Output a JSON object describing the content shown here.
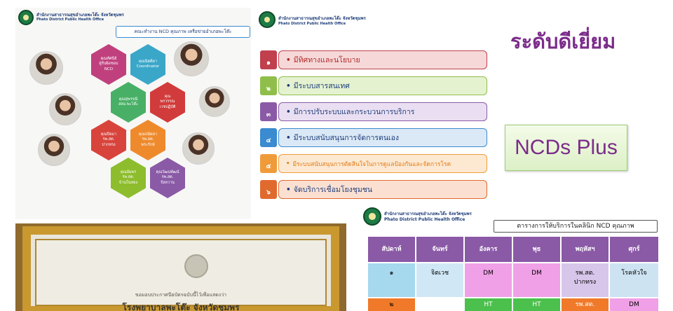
{
  "header": {
    "org_th": "สำนักงานสาธารณสุขอำเภอพะโต๊ะ จังหวัดชุมพร",
    "org_en": "Phato District Public Health Office"
  },
  "team_slide": {
    "title": "คณะทำงาน NCD คุณภาพ เครือข่ายอำเภอพะโต๊ะ",
    "hexes": [
      {
        "text": "คุณทัศนีย์\nผู้รับผิดชอบ\nNCD",
        "color": "#c0407e"
      },
      {
        "text": "คุณนิตติยา\nCoordinator",
        "color": "#3aa7c9"
      },
      {
        "text": "คุณสุพรรณี\nสสอ.พะโต๊ะ",
        "color": "#48b066"
      },
      {
        "text": "คุณ\nพรวรรณ\nเวชปฏิบัติ",
        "color": "#d23b3b"
      },
      {
        "text": "คุณปิยมา\nรพ.สต.\nปากทรง",
        "color": "#d8443c"
      },
      {
        "text": "คุณปนัดดา\nรพ.สต.\nพระรักษ์",
        "color": "#ef8a2c"
      },
      {
        "text": "คุณอัมพร\nรพ.สต.\nบ้านในหยง",
        "color": "#8dbd2c"
      },
      {
        "text": "คุณวัฒนพัฒน์\nรพ.สต.\nปังหวาน",
        "color": "#8a5aa6"
      }
    ]
  },
  "list_slide": {
    "items": [
      {
        "num": "๑",
        "label": "มีทิศทางและนโยบาย",
        "tab": "#c0404e",
        "fill": "#f6d8d8",
        "border": "#c0404e",
        "text": "#b02a2a"
      },
      {
        "num": "๒",
        "label": "มีระบบสารสนเทศ",
        "tab": "#8fbf4a",
        "fill": "#e4f2d0",
        "border": "#8fbf4a",
        "text": "#1f3e7a"
      },
      {
        "num": "๓",
        "label": "มีการปรับระบบและกระบวนการบริการ",
        "tab": "#8a5aa6",
        "fill": "#eadff2",
        "border": "#8a5aa6",
        "text": "#1f3e7a"
      },
      {
        "num": "๔",
        "label": "มีระบบสนับสนุนการจัดการตนเอง",
        "tab": "#3a8bd0",
        "fill": "#dbe9f7",
        "border": "#3a8bd0",
        "text": "#1f3e7a"
      },
      {
        "num": "๕",
        "label": "มีระบบสนับสนุนการตัดสินใจในการดูแลป้องกันและจัดการโรค",
        "tab": "#f09b3a",
        "fill": "#fde9d2",
        "border": "#f09b3a",
        "text": "#e07b1a"
      },
      {
        "num": "๖",
        "label": "จัดบริการเชื่อมโยงชุมชน",
        "tab": "#e06a2e",
        "fill": "#fbe0d2",
        "border": "#e06a2e",
        "text": "#1f3e7a"
      }
    ]
  },
  "right": {
    "title": "ระดับดีเยี่ยม",
    "box_label": "NCDs Plus"
  },
  "certificate": {
    "line1": "ขอมอบประกาศนียบัตรฉบับนี้ไว้เพื่อแสดงว่า",
    "line2": "โรงพยาบาลพะโต๊ะ จังหวัดชุมพร"
  },
  "schedule": {
    "title": "ตารางการให้บริการในคลินิก NCD คุณภาพ",
    "headers": [
      "สัปดาห์",
      "จันทร์",
      "อังคาร",
      "พุธ",
      "พฤหัสฯ",
      "ศุกร์"
    ],
    "rows": [
      {
        "cells": [
          "๑",
          "จิตเวช",
          "DM",
          "DM",
          "รพ.สต.\nปากทรง",
          "โรคหัวใจ"
        ],
        "colors": [
          "#a6d8ee",
          "#d0e8f5",
          "#f0a0e6",
          "#f0a0e6",
          "#d8c6ea",
          "#cde3f2"
        ]
      },
      {
        "cells": [
          "๒",
          "",
          "HT",
          "HT",
          "รพ.สต.",
          "DM"
        ],
        "colors": [
          "#f07a2a",
          "#ffffff",
          "#4cc04c",
          "#4cc04c",
          "#f07a2a",
          "#f0a0e6"
        ]
      }
    ]
  }
}
